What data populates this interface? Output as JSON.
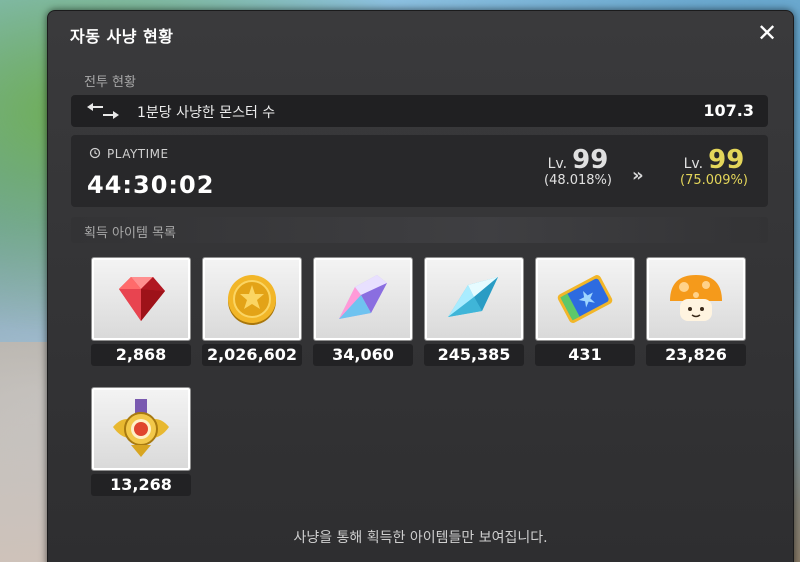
{
  "window": {
    "title": "자동 사냥 현황",
    "close_label": "✕"
  },
  "battle": {
    "section_label": "전투 현황",
    "rate_label": "1분당 사냥한 몬스터 수",
    "rate_value": "107.3",
    "playtime_label": "PLAYTIME",
    "playtime_value": "44:30:02",
    "level_from": {
      "prefix": "Lv.",
      "level": "99",
      "percent": "(48.018%)"
    },
    "level_arrow": "»",
    "level_to": {
      "prefix": "Lv.",
      "level": "99",
      "percent": "(75.009%)"
    }
  },
  "items_section": {
    "label": "획득 아이템 목록",
    "items": [
      {
        "icon": "red-gem-icon",
        "count": "2,868"
      },
      {
        "icon": "gold-coin-icon",
        "count": "2,026,602"
      },
      {
        "icon": "prism-crystal-icon",
        "count": "34,060"
      },
      {
        "icon": "blue-crystal-icon",
        "count": "245,385"
      },
      {
        "icon": "blue-ticket-icon",
        "count": "431"
      },
      {
        "icon": "orange-mushroom-icon",
        "count": "23,826"
      },
      {
        "icon": "gold-emblem-icon",
        "count": "13,268"
      }
    ]
  },
  "footer": {
    "note": "사냥을 통해 획득한 아이템들만 보여집니다."
  },
  "colors": {
    "panel_bg": "#2e2e30",
    "row_bg": "#202022",
    "target_level": "#e4d65a"
  }
}
